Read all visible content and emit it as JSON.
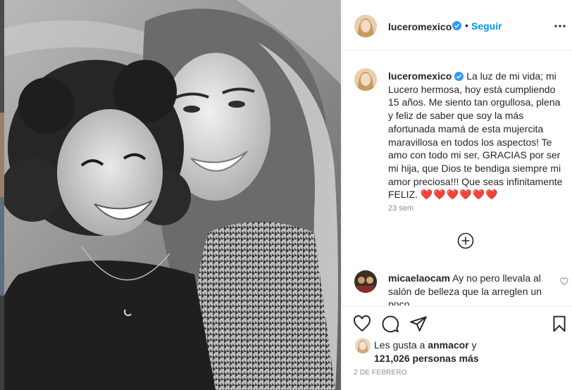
{
  "post": {
    "username": "luceromexico",
    "verified": true,
    "follow_label": "Seguir",
    "separator": "•",
    "caption": "La luz de mi vida; mi Lucero hermosa, hoy está cumpliendo 15 años. Me siento tan orgullosa, plena y feliz de saber que soy la más afortunada mamá de esta mujercita maravillosa en todos los aspectos! Te amo con todo mi ser, GRACIAS por ser mi hija, que Dios te bendiga siempre mi amor preciosa!!! Que seas infinitamente FELIZ.",
    "caption_hearts": "❤️❤️❤️❤️❤️❤️",
    "time_ago": "23 sem",
    "date": "2 DE FEBRERO"
  },
  "comments": [
    {
      "username": "micaelaocam",
      "text": "Ay no pero llevala al salón de belleza que la arreglen un poco"
    }
  ],
  "likes": {
    "prefix": "Les gusta a",
    "first_user": "anmacor",
    "conjunction": "y",
    "count": "121,026 personas más"
  },
  "icons": {
    "more": "more-options-icon",
    "verified": "verified-badge-icon",
    "load_more": "plus-circle-icon",
    "like": "heart-icon",
    "comment": "comment-bubble-icon",
    "share": "paper-plane-icon",
    "save": "bookmark-icon"
  },
  "colors": {
    "accent": "#0095f6",
    "heart": "#d0121b",
    "muted": "#8e8e8e",
    "text": "#262626"
  }
}
